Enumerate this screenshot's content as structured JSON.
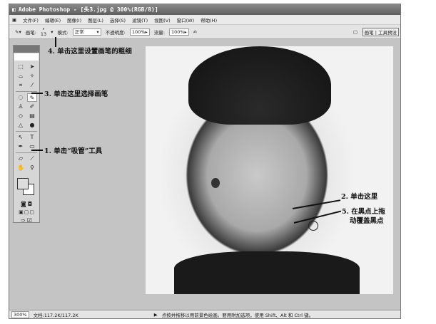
{
  "window": {
    "title": "Adobe Photoshop - [头3.jpg @ 300%(RGB/8)]"
  },
  "menu": [
    "文件(F)",
    "编辑(E)",
    "图像(I)",
    "图层(L)",
    "选择(S)",
    "滤镜(T)",
    "视图(V)",
    "窗口(W)",
    "帮助(H)"
  ],
  "options": {
    "brush_label": "画笔:",
    "brush_size": "13",
    "mode_label": "模式:",
    "mode_value": "正常",
    "opacity_label": "不透明度:",
    "opacity_value": "100%",
    "flow_label": "流量:",
    "flow_value": "100%",
    "tab_brush": "画笔",
    "tab_presets": "工具预设"
  },
  "toolbox": {
    "tools": [
      "marquee",
      "move",
      "lasso",
      "magic-wand",
      "crop",
      "slice",
      "healing",
      "brush",
      "stamp",
      "history-brush",
      "eraser",
      "gradient",
      "blur",
      "dodge",
      "path-select",
      "type",
      "pen",
      "shape",
      "notes",
      "eyedropper",
      "hand",
      "zoom"
    ]
  },
  "status": {
    "zoom": "300%",
    "doc": "文档:117.2K/117.2K",
    "hint": "点按并拖移以用前景色绘画。要用附加选项，使用 Shift、Alt 和 Ctrl 键。"
  },
  "annotations": {
    "a1": "1. 单击“吸管”工具",
    "a2": "2. 单击这里",
    "a3": "3. 单击这里选择画笔",
    "a4": "4. 单击这里设置画笔的粗细",
    "a5a": "5. 在黑点上拖",
    "a5b": "动覆盖黑点"
  }
}
